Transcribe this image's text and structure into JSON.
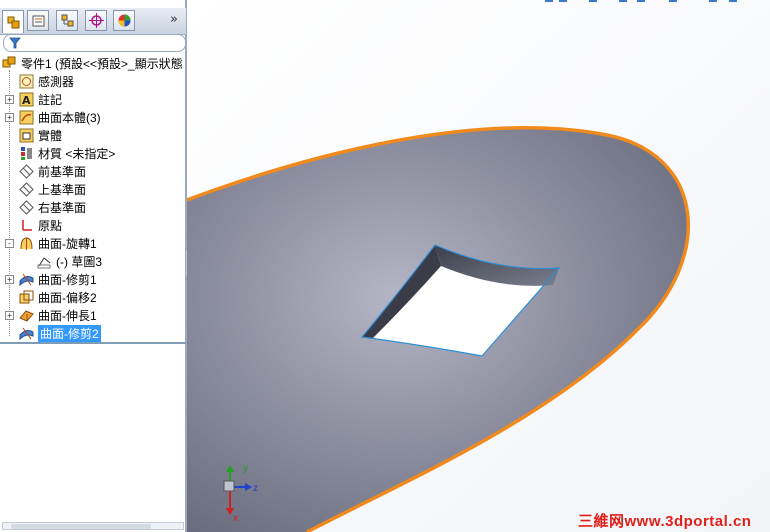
{
  "feature_manager": {
    "tabs": [
      {
        "name": "feature-tree"
      },
      {
        "name": "property-manager"
      },
      {
        "name": "configuration-manager"
      },
      {
        "name": "dimxpert"
      },
      {
        "name": "display-manager"
      }
    ],
    "more_label": "»",
    "tree": [
      {
        "label": "零件1 (預設<<預設>_顯示狀態",
        "icon": "part-icon",
        "level": 0
      },
      {
        "label": "感測器",
        "icon": "sensors-icon",
        "level": 1
      },
      {
        "label": "註記",
        "icon": "annotations-icon",
        "level": 1,
        "expandable": true
      },
      {
        "label": "曲面本體(3)",
        "icon": "surface-bodies-icon",
        "level": 1,
        "expandable": true
      },
      {
        "label": "實體",
        "icon": "solid-bodies-icon",
        "level": 1
      },
      {
        "label": "材質 <未指定>",
        "icon": "material-icon",
        "level": 1
      },
      {
        "label": "前基準面",
        "icon": "plane-icon",
        "level": 1
      },
      {
        "label": "上基準面",
        "icon": "plane-icon",
        "level": 1
      },
      {
        "label": "右基準面",
        "icon": "plane-icon",
        "level": 1
      },
      {
        "label": "原點",
        "icon": "origin-icon",
        "level": 1
      },
      {
        "label": "曲面-旋轉1",
        "icon": "surface-revolve-icon",
        "level": 1,
        "expandable": true,
        "expanded": true
      },
      {
        "label": "(-) 草圖3",
        "icon": "sketch-icon",
        "level": 2
      },
      {
        "label": "曲面-修剪1",
        "icon": "surface-trim-icon",
        "level": 1,
        "expandable": true
      },
      {
        "label": "曲面-偏移2",
        "icon": "surface-offset-icon",
        "level": 1
      },
      {
        "label": "曲面-伸長1",
        "icon": "surface-extrude-icon",
        "level": 1,
        "expandable": true
      },
      {
        "label": "曲面-修剪2",
        "icon": "surface-trim-icon",
        "level": 1,
        "selected": true
      }
    ]
  },
  "viewport": {
    "triad": {
      "x": "x",
      "y": "y",
      "z": "z"
    },
    "watermark": "三維网www.3dportal.cn"
  },
  "colors": {
    "surface_edge": "#f08a1c",
    "selection": "#3399ff",
    "hole_edge": "#2d8fd8",
    "watermark": "#e0201b"
  }
}
